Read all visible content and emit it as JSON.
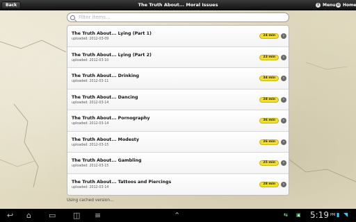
{
  "topbar": {
    "back_label": "Back",
    "title": "The Truth About... Moral Issues",
    "menu_label": "Menu",
    "home_label": "Home"
  },
  "filter": {
    "placeholder": "Filter items..."
  },
  "items": [
    {
      "title": "The Truth About... Lying (Part 1)",
      "uploaded": "uploaded: 2012-03-09",
      "duration": "24 min"
    },
    {
      "title": "The Truth About... Lying (Part 2)",
      "uploaded": "uploaded: 2012-03-10",
      "duration": "23 min"
    },
    {
      "title": "The Truth About... Drinking",
      "uploaded": "uploaded: 2012-03-11",
      "duration": "34 min"
    },
    {
      "title": "The Truth About... Dancing",
      "uploaded": "uploaded: 2012-03-14",
      "duration": "28 min"
    },
    {
      "title": "The Truth About... Pornography",
      "uploaded": "uploaded: 2012-03-14",
      "duration": "36 min"
    },
    {
      "title": "The Truth About... Modesty",
      "uploaded": "uploaded: 2012-03-15",
      "duration": "26 min"
    },
    {
      "title": "The Truth About... Gambling",
      "uploaded": "uploaded: 2012-03-15",
      "duration": "25 min"
    },
    {
      "title": "The Truth About... Tattoos and Piercings",
      "uploaded": "uploaded: 2012-03-14",
      "duration": "28 min"
    }
  ],
  "status": "Using cached version...",
  "system": {
    "clock": "5:19",
    "ampm": "PM"
  },
  "colors": {
    "badge": "#f3de2c",
    "topbar": "#1e1e1e",
    "background": "#e6e0c8"
  }
}
